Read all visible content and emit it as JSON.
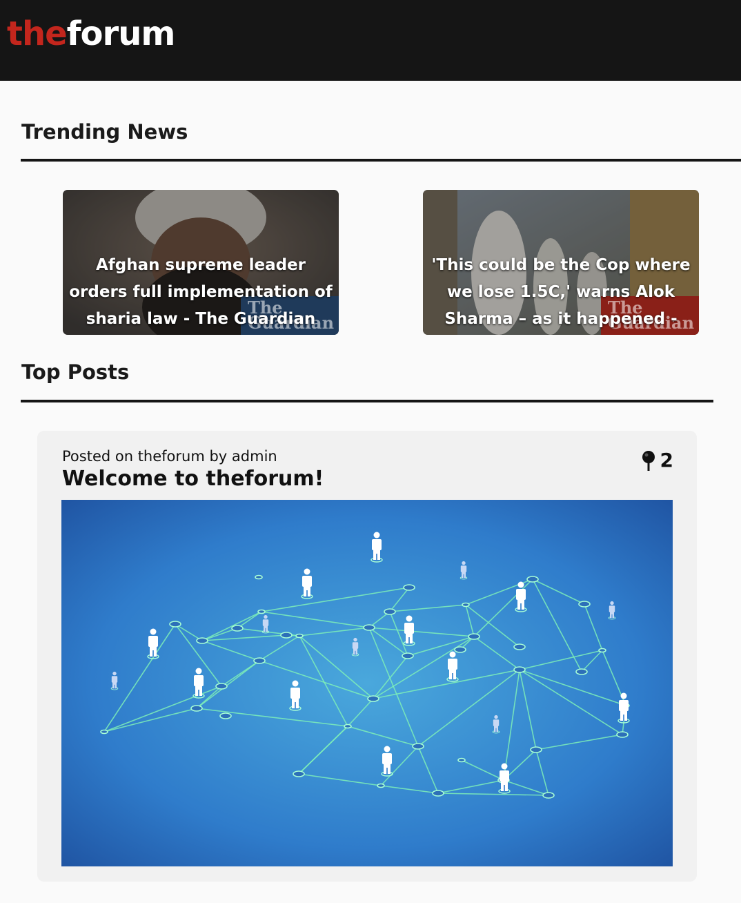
{
  "header": {
    "logo_part1": "the",
    "logo_part2": "forum"
  },
  "trending": {
    "title": "Trending News",
    "items": [
      {
        "headline": "Afghan supreme leader orders full implementation of sharia law - The Guardian",
        "watermark_line1": "The",
        "watermark_line2": "Guardian"
      },
      {
        "headline": "'This could be the Cop where we lose 1.5C,' warns Alok Sharma – as it happened - The Guardian",
        "watermark_line1": "The",
        "watermark_line2": "Guardian"
      }
    ]
  },
  "top_posts": {
    "title": "Top Posts",
    "posts": [
      {
        "meta": "Posted on theforum by admin",
        "title": "Welcome to theforum!",
        "pin_count": "2",
        "icon": "pin-icon"
      }
    ]
  },
  "colors": {
    "brand_red": "#c3261d",
    "header_bg": "#151515",
    "network_line": "#7ef0b8",
    "network_bg": "#2a73c4"
  }
}
